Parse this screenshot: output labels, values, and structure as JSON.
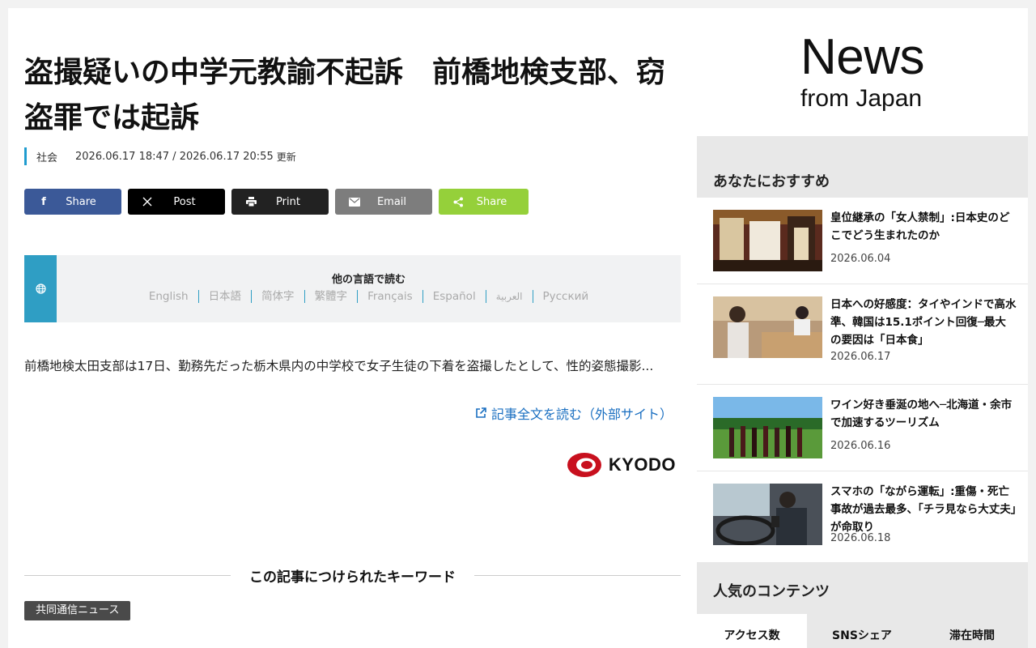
{
  "article": {
    "headline_line1": "盗撮疑いの中学元教諭不起訴　前橋地検支部、窃",
    "headline_line2": "盗罪では起訴",
    "category": "社会",
    "dates": "2026.06.17 18:47 / 2026.06.17 20:55",
    "updated_label": "更新",
    "body": "前橋地検太田支部は17日、勤務先だった栃木県内の中学校で女子生徒の下着を盗撮したとして、性的姿態撮影...",
    "read_more": "記事全文を読む（外部サイト）",
    "source_logo": "KYODO"
  },
  "share_buttons": [
    {
      "label": "Share",
      "icon": "facebook-icon"
    },
    {
      "label": "Post",
      "icon": "x-icon"
    },
    {
      "label": "Print",
      "icon": "print-icon"
    },
    {
      "label": "Email",
      "icon": "email-icon"
    },
    {
      "label": "Share",
      "icon": "share-icon"
    }
  ],
  "languages": {
    "title": "他の言語で読む",
    "items": [
      "English",
      "日本語",
      "简体字",
      "繁體字",
      "Français",
      "Español",
      "العربية",
      "Русский"
    ]
  },
  "keywords": {
    "title": "この記事につけられたキーワード",
    "tags": [
      "共同通信ニュース"
    ]
  },
  "sidebar": {
    "brand_big": "News",
    "brand_small": "from Japan",
    "recommend_title": "あなたにおすすめ",
    "recommend": [
      {
        "title": "皇位継承の「女人禁制」:日本史のどこでどう生まれたのか",
        "date": "2026.06.04"
      },
      {
        "title": "日本への好感度：タイやインドで高水準、韓国は15.1ポイント回復─最大の要因は「日本食」",
        "date": "2026.06.17"
      },
      {
        "title": "ワイン好き垂涎の地へ─北海道・余市で加速するツーリズム",
        "date": "2026.06.16"
      },
      {
        "title": "スマホの「ながら運転」:重傷・死亡事故が過去最多、「チラ見なら大丈夫」が命取り",
        "date": "2026.06.18"
      }
    ],
    "popular_title": "人気のコンテンツ",
    "tabs": [
      "アクセス数",
      "SNSシェア",
      "滞在時間"
    ]
  },
  "colors": {
    "accent": "#1f9ccf",
    "facebook": "#3b5998",
    "x": "#000000",
    "print": "#222222",
    "email": "#7d7d7d",
    "share": "#95d03a",
    "link": "#1a6fc1",
    "kyodo_red": "#c8101e"
  }
}
